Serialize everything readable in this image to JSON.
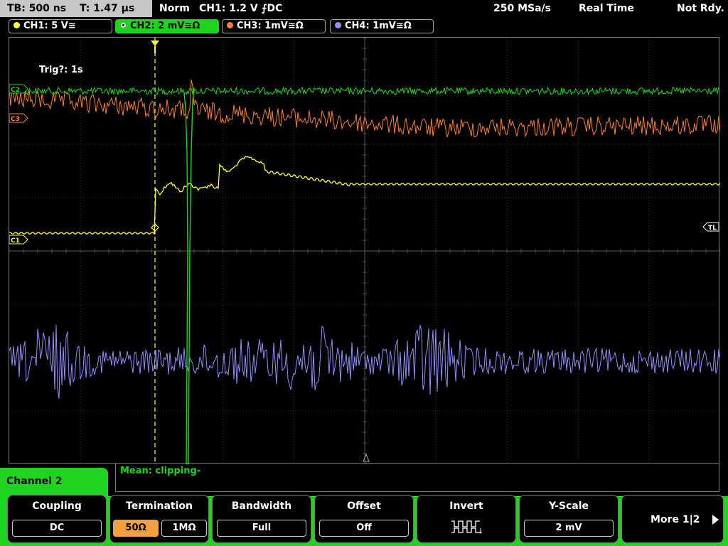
{
  "topbar": {
    "timebase": "TB: 500 ns",
    "trigger_time": "T: 1.47 µs",
    "acq_mode": "Norm",
    "trigger_info": "CH1: 1.2 V ⨍DC",
    "sample_rate": "250 MSa/s",
    "display_mode": "Real Time",
    "run_status": "Not Rdy."
  },
  "channels": [
    {
      "label": "CH1: 5 V≅",
      "color": "#ffff30",
      "active": false
    },
    {
      "label": "CH2: 2 mV≅Ω",
      "color": "#1fd41f",
      "active": true
    },
    {
      "label": "CH3: 1mV≅Ω",
      "color": "#ff8030",
      "active": false
    },
    {
      "label": "CH4: 1mV≅Ω",
      "color": "#9090ff",
      "active": false
    }
  ],
  "scope": {
    "trigger_countdown": "Trig?: 1s",
    "marker_c2": "C2",
    "marker_c3": "C3",
    "marker_c1": "C1",
    "marker_tl": "TL"
  },
  "measurement": {
    "text": "Mean: clipping-"
  },
  "menu": {
    "title": "Channel 2",
    "coupling_label": "Coupling",
    "coupling_value": "DC",
    "termination_label": "Termination",
    "termination_50": "50Ω",
    "termination_1m": "1MΩ",
    "termination_selected": "50Ω",
    "bandwidth_label": "Bandwidth",
    "bandwidth_value": "Full",
    "offset_label": "Offset",
    "offset_value": "Off",
    "invert_label": "Invert",
    "yscale_label": "Y-Scale",
    "yscale_value": "2 mV",
    "more_label": "More 1|2"
  },
  "colors": {
    "ch1": "#ffff30",
    "ch2": "#1fd41f",
    "ch3": "#ff8030",
    "ch4": "#9090ff",
    "grid": "#5a5a5a"
  }
}
